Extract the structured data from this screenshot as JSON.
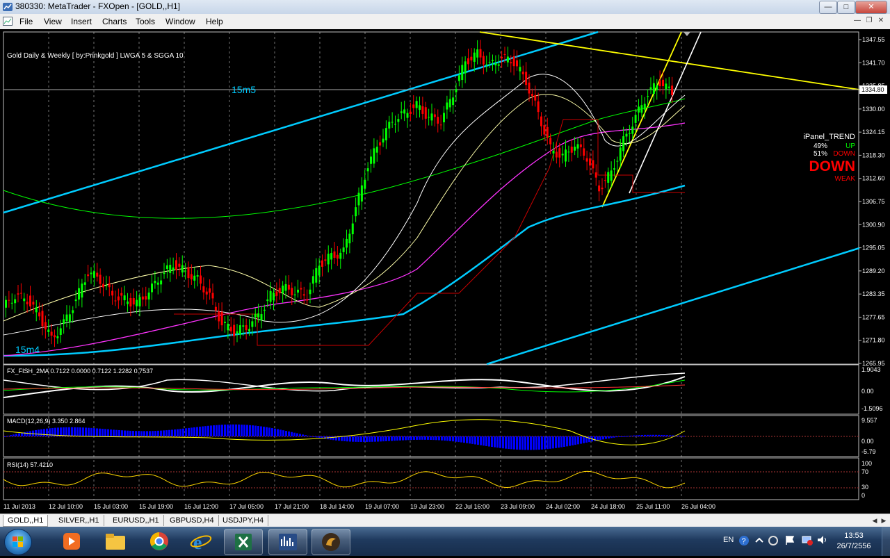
{
  "window": {
    "title": "380330: MetaTrader - FXOpen - [GOLD,,H1]"
  },
  "menu": [
    "File",
    "View",
    "Insert",
    "Charts",
    "Tools",
    "Window",
    "Help"
  ],
  "chart": {
    "header": "Gold Daily & Weekly [ by:Prinkgold ]  LWGA 5  &  SGGA 10",
    "labels": {
      "fifteen_m5": "15m5",
      "fifteen_m4": "15m4"
    },
    "current_price": "1334.80",
    "price_axis": [
      "1347.55",
      "1341.70",
      "1335.85",
      "1330.00",
      "1324.15",
      "1318.30",
      "1312.60",
      "1306.75",
      "1300.90",
      "1295.05",
      "1289.20",
      "1283.35",
      "1277.65",
      "1271.80",
      "1265.95"
    ],
    "time_axis": [
      "11 Jul 2013",
      "12 Jul 10:00",
      "15 Jul 03:00",
      "15 Jul 19:00",
      "16 Jul 12:00",
      "17 Jul 05:00",
      "17 Jul 21:00",
      "18 Jul 14:00",
      "19 Jul 07:00",
      "19 Jul 23:00",
      "22 Jul 16:00",
      "23 Jul 09:00",
      "24 Jul 02:00",
      "24 Jul 18:00",
      "25 Jul 11:00",
      "26 Jul 04:00"
    ],
    "ipanel": {
      "title": "iPanel_TREND",
      "up_pct": "49%",
      "up_label": "UP",
      "down_pct": "51%",
      "down_label": "DOWN",
      "big": "DOWN",
      "strength": "WEAK"
    },
    "colors": {
      "bull": "#00ff00",
      "bear": "#ff0000",
      "trend_line": "#00ccff",
      "resistance": "#ffff00",
      "grid": "#c0c0c0",
      "text": "#ffffff"
    },
    "price_series": [
      1280,
      1283,
      1282,
      1278,
      1272,
      1276,
      1282,
      1289,
      1287,
      1283,
      1282,
      1281,
      1284,
      1288,
      1291,
      1289,
      1287,
      1283,
      1276,
      1274,
      1275,
      1278,
      1283,
      1285,
      1284,
      1283,
      1291,
      1293,
      1294,
      1305,
      1316,
      1322,
      1327,
      1329,
      1331,
      1328,
      1327,
      1334,
      1342,
      1344,
      1341,
      1343,
      1342,
      1337,
      1329,
      1320,
      1318,
      1321,
      1318,
      1310,
      1314,
      1322,
      1328,
      1334,
      1337,
      1334
    ],
    "sub_windows": [
      {
        "name": "FX_FISH_2MA 0.7122 0.0000 0.7122 1.2282 0.7537",
        "ticks": [
          "1.9043",
          "0.00",
          "-1.5096"
        ]
      },
      {
        "name": "MACD(12,26,9) 3.350 2.864",
        "ticks": [
          "9.557",
          "0.00",
          "-5.79"
        ]
      },
      {
        "name": "RSI(14) 57.4210",
        "ticks": [
          "100",
          "70",
          "30",
          "0"
        ]
      }
    ]
  },
  "tabs": [
    "GOLD,,H1",
    "SILVER,,H1",
    "EURUSD,,H1",
    "GBPUSD,H4",
    "USDJPY,H4"
  ],
  "tray": {
    "lang": "EN",
    "time": "13:53",
    "date": "26/7/2556"
  }
}
